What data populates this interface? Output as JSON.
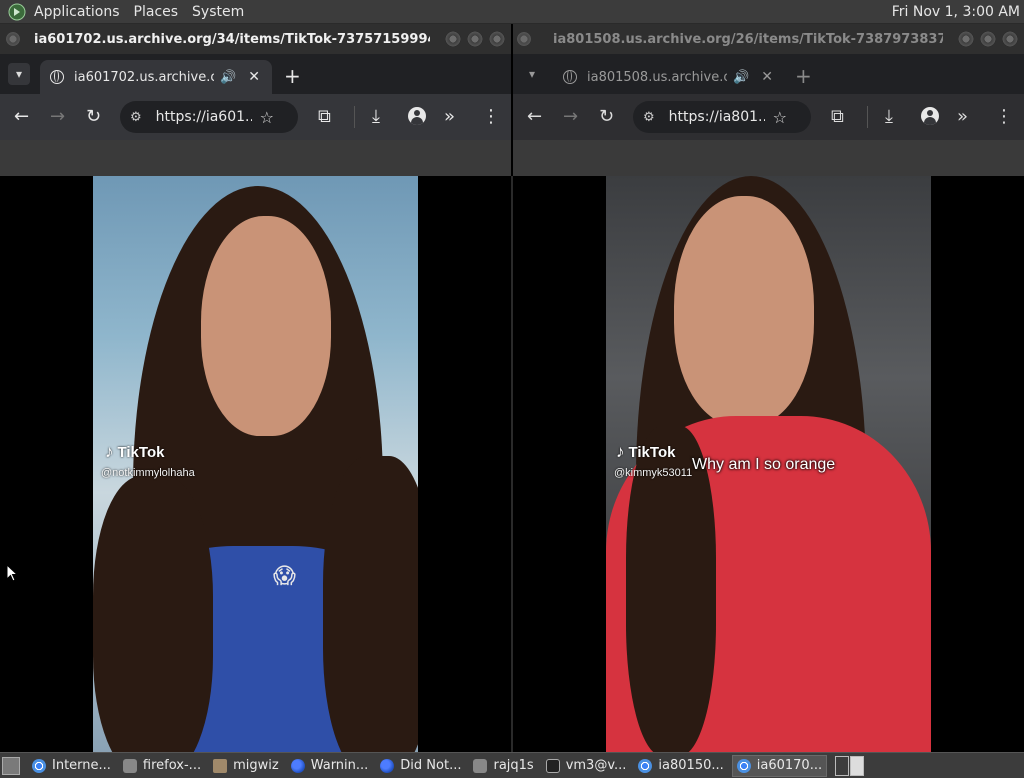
{
  "panel": {
    "menus": [
      "Applications",
      "Places",
      "System"
    ],
    "clock": "Fri Nov 1,  3:00 AM"
  },
  "left_window": {
    "title": "ia601702.us.archive.org/34/items/TikTok-737571599941430...",
    "tab_title": "ia601702.us.archive.org/3",
    "url": "https://ia601...",
    "video": {
      "brand": "TikTok",
      "handle": "@notkimmylolhaha",
      "emoji": "😱"
    }
  },
  "right_window": {
    "title": "ia801508.us.archive.org/26/items/TikTok-738797383789324...",
    "tab_title": "ia801508.us.archive.org/",
    "url": "https://ia801...",
    "video": {
      "brand": "TikTok",
      "handle": "@kimmyk53011",
      "caption": "Why am I so orange"
    }
  },
  "icons": {
    "tab_menu": "▾",
    "speaker": "🔊",
    "close": "✕",
    "new_tab": "+",
    "back": "←",
    "forward": "→",
    "reload": "↻",
    "site_settings": "⚙",
    "bookmark": "☆",
    "extensions": "⧉",
    "download": "⤓",
    "more_tools": "»",
    "menu": "⋮",
    "tiktok_note": "♪"
  },
  "taskbar": {
    "tasks": [
      {
        "label": "Interne...",
        "icon": "chrome"
      },
      {
        "label": "firefox-...",
        "icon": "doc"
      },
      {
        "label": "migwiz",
        "icon": "folder"
      },
      {
        "label": "Warnin...",
        "icon": "ff"
      },
      {
        "label": "Did Not...",
        "icon": "ff"
      },
      {
        "label": "rajq1s",
        "icon": "doc"
      },
      {
        "label": "vm3@v...",
        "icon": "term"
      },
      {
        "label": "ia80150...",
        "icon": "chrome"
      },
      {
        "label": "ia60170...",
        "icon": "chrome",
        "active": true
      }
    ]
  }
}
